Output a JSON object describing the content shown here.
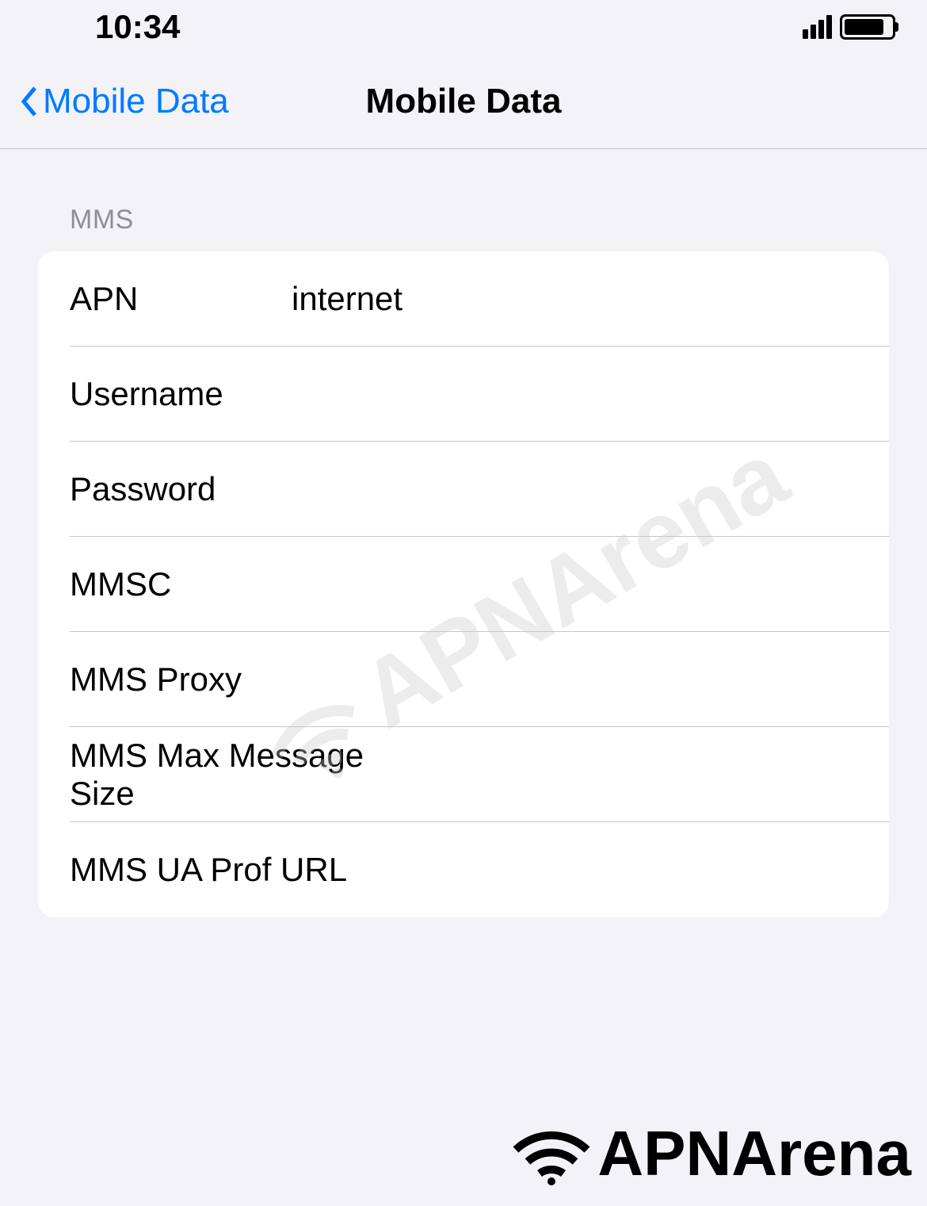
{
  "status_bar": {
    "time": "10:34"
  },
  "nav": {
    "back_label": "Mobile Data",
    "title": "Mobile Data"
  },
  "section": {
    "header": "MMS",
    "rows": [
      {
        "label": "APN",
        "value": "internet"
      },
      {
        "label": "Username",
        "value": ""
      },
      {
        "label": "Password",
        "value": ""
      },
      {
        "label": "MMSC",
        "value": ""
      },
      {
        "label": "MMS Proxy",
        "value": ""
      },
      {
        "label": "MMS Max Message Size",
        "value": ""
      },
      {
        "label": "MMS UA Prof URL",
        "value": ""
      }
    ]
  },
  "branding": {
    "watermark": "APNArena",
    "footer": "APNArena"
  }
}
